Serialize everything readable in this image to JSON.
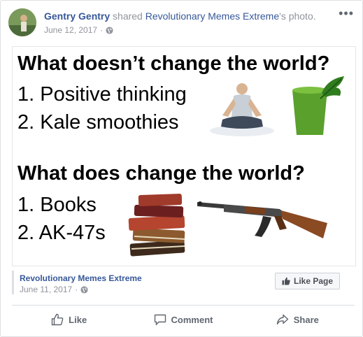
{
  "post": {
    "author": "Gentry Gentry",
    "shared_text": "shared",
    "source_page": "Revolutionary Memes Extreme",
    "source_suffix": "'s photo.",
    "date": "June 12, 2017",
    "date_separator": "·",
    "audience_icon": "globe-icon",
    "more_icon": "ellipsis-icon"
  },
  "meme": {
    "question1": "What doesn’t change the world?",
    "answers1": [
      "1. Positive thinking",
      "2. Kale smoothies"
    ],
    "question2": "What does change the world?",
    "answers2": [
      "1. Books",
      "2. AK-47s"
    ]
  },
  "shared_from": {
    "name": "Revolutionary Memes Extreme",
    "date": "June 11, 2017",
    "date_separator": "·",
    "like_page_label": "Like Page"
  },
  "actions": {
    "like": "Like",
    "comment": "Comment",
    "share": "Share"
  },
  "colors": {
    "link": "#365899",
    "muted": "#90949c",
    "action_text": "#606770"
  }
}
